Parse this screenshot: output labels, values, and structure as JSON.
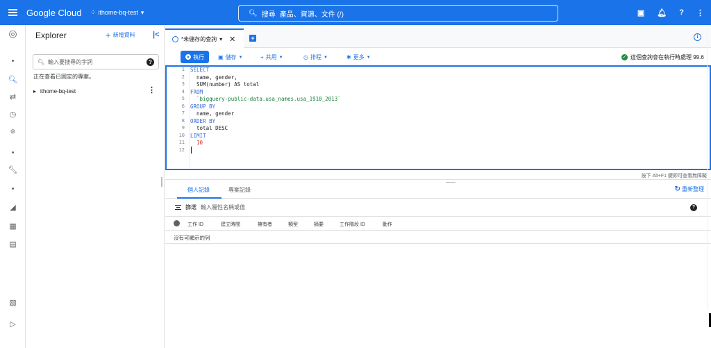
{
  "topbar": {
    "brand": "Google Cloud",
    "project": "ithome-bq-test",
    "search_label": "搜尋",
    "search_hint": "產品、資源、文件 (/)",
    "icons": [
      "terminal-icon",
      "bell-icon",
      "help-icon",
      "more-vert-icon"
    ]
  },
  "rail": {
    "icons": [
      "bigquery-logo-icon",
      "dot-icon",
      "search-icon",
      "transfer-icon",
      "clock-icon",
      "analytics-icon",
      "dot-icon",
      "wrench-icon",
      "dot-icon",
      "chart-icon",
      "dashboard-icon",
      "table-icon",
      "notes-icon",
      "expand-icon"
    ]
  },
  "explorer": {
    "title": "Explorer",
    "add_data": "新增資料",
    "search_placeholder": "輸入要搜尋的字詞",
    "note": "正在查看已固定的專案。",
    "project_name": "ithome-bq-test"
  },
  "tab": {
    "label": "*未儲存的查詢"
  },
  "toolbar": {
    "run": "執行",
    "save": "儲存",
    "share": "共用",
    "schedule": "排程",
    "more": "更多",
    "status": "這個查詢會在執行時處理 99.6"
  },
  "editor": {
    "lines": [
      {
        "n": "1",
        "text": "SELECT"
      },
      {
        "n": "2",
        "text": "  name, gender,"
      },
      {
        "n": "3",
        "text": "  SUM(number) AS total"
      },
      {
        "n": "4",
        "text": "FROM"
      },
      {
        "n": "5",
        "text": "  `bigquery-public-data.usa_names.usa_1910_2013`"
      },
      {
        "n": "6",
        "text": "GROUP BY"
      },
      {
        "n": "7",
        "text": "  name, gender"
      },
      {
        "n": "8",
        "text": "ORDER BY"
      },
      {
        "n": "9",
        "text": "  total DESC"
      },
      {
        "n": "10",
        "text": "LIMIT"
      },
      {
        "n": "11",
        "text": "  10"
      },
      {
        "n": "12",
        "text": ""
      }
    ],
    "hint": "按下 Alt+F1 鍵即可查看無障礙"
  },
  "results": {
    "tab_personal": "個人記錄",
    "tab_project": "專案記錄",
    "refresh": "重新整理",
    "filter_label": "篩選",
    "filter_placeholder": "輸入屬性名稱或值",
    "columns": [
      "工作 ID",
      "建立時間",
      "擁有者",
      "類型",
      "摘要",
      "工作階段 ID",
      "動作"
    ],
    "empty": "沒有可顯示的列"
  },
  "colors": {
    "primary": "#1a73e8",
    "success": "#1e8e3e"
  }
}
